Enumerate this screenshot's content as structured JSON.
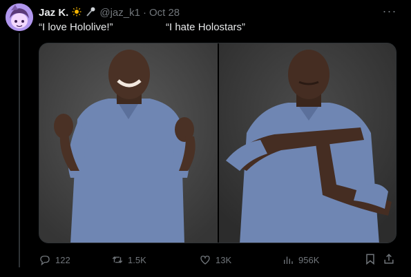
{
  "post": {
    "author_name": "Jaz K.",
    "author_handle": "@jaz_k1",
    "separator": "·",
    "timestamp": "Oct 28",
    "text_left": "“I love Hololive!”",
    "text_right": "“I hate Holostars”",
    "more_label": "···",
    "badges": [
      "sun-icon",
      "microphone-icon"
    ]
  },
  "actions": {
    "replies": "122",
    "reposts": "1.5K",
    "likes": "13K",
    "views": "956K"
  },
  "colors": {
    "background": "#000000",
    "text_primary": "#e7e9ea",
    "text_secondary": "#71767b",
    "border": "#2f3336",
    "sun": "#f4b400"
  }
}
